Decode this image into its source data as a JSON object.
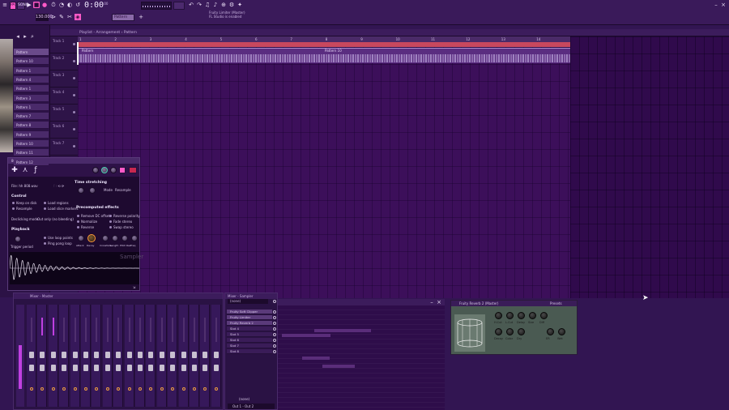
{
  "toolbar": {
    "time": "0:00",
    "time_unit": ":00",
    "tempo": "130.000",
    "pattern": "Pattern",
    "hint_line1": "Fruity Limiter (Master)",
    "hint_line2": "FL Studio is enabled",
    "song_mode": "SONG",
    "pat_mode": "PAT"
  },
  "browser": {
    "items": [
      "Pattern",
      "Pattern 10",
      "Pattern 1",
      "Pattern 4",
      "Pattern 1",
      "Pattern 3",
      "Pattern 1",
      "Pattern 7",
      "Pattern 8",
      "Pattern 9",
      "Pattern 10",
      "Pattern 11",
      "Pattern 12"
    ]
  },
  "playlist": {
    "title": "Playlist - Arrangement › Pattern",
    "tracks": [
      "Track 1",
      "Track 2",
      "Track 3",
      "Track 4",
      "Track 5",
      "Track 6",
      "Track 7"
    ],
    "ruler": [
      "1",
      "2",
      "3",
      "4",
      "5",
      "6",
      "7",
      "8",
      "9",
      "10",
      "11",
      "12",
      "13",
      "14"
    ],
    "clip_a": "Pattern",
    "clip_b": "Pattern 10"
  },
  "sampler": {
    "title": "808 HH (Insert 1)",
    "file": "File: hh 808.wav",
    "time_stretching": "Time stretching",
    "mode_label": "Mode",
    "mode_value": "Resample",
    "control": "Control",
    "keep_on_disk": "Keep on disk",
    "load_regions": "Load regions",
    "resample": "Resample",
    "load_slices": "Load slice markers",
    "declicking": "Declicking mode",
    "declicking_value": "Out only (no bleeding)",
    "precomputed": "Precomputed effects",
    "remove_dc": "Remove DC offset",
    "reverse_polarity": "Reverse polarity",
    "normalize": "Normalize",
    "fade_stereo": "Fade stereo",
    "reverse": "Reverse",
    "swap_stereo": "Swap stereo",
    "playback": "Playback",
    "use_loop": "Use loop points",
    "ping_pong": "Ping pong loop",
    "trigger_period": "Trigger period",
    "sampler_watermark": "Sampler",
    "knob_labels": [
      "Amp",
      "Vol",
      "Pan",
      "Fine"
    ],
    "fx_knob_labels": [
      "Attack",
      "Decay",
      "Crossfade",
      "Length",
      "Pitch",
      "Res",
      "Freq"
    ]
  },
  "mixer": {
    "title": "Mixer - Master",
    "strip_count": 18
  },
  "inserts": {
    "title": "Mixer - Sampler",
    "selector": "(none)",
    "slots": [
      "Fruity Soft Clipper",
      "Fruity Limiter",
      "Fruity Reverb 2",
      "Slot 4",
      "Slot 5",
      "Slot 6",
      "Slot 7",
      "Slot 8"
    ],
    "none_label": "(none)",
    "output": "Out 1 - Out 2"
  },
  "reverb": {
    "title": "Fruity Reverb 2 (Master)",
    "presets": "Presets",
    "knob_labels": [
      "H.Cut",
      "L.Cut",
      "Delay",
      "Size",
      "Diff",
      "Decay",
      "Color",
      "Dry",
      "ER",
      "Wet"
    ]
  },
  "colors": {
    "accent_pink": "#ff5ac8",
    "loop_red": "#c8485e",
    "grid_purple": "#3c0f5a",
    "master_meter": "#c040e0"
  }
}
